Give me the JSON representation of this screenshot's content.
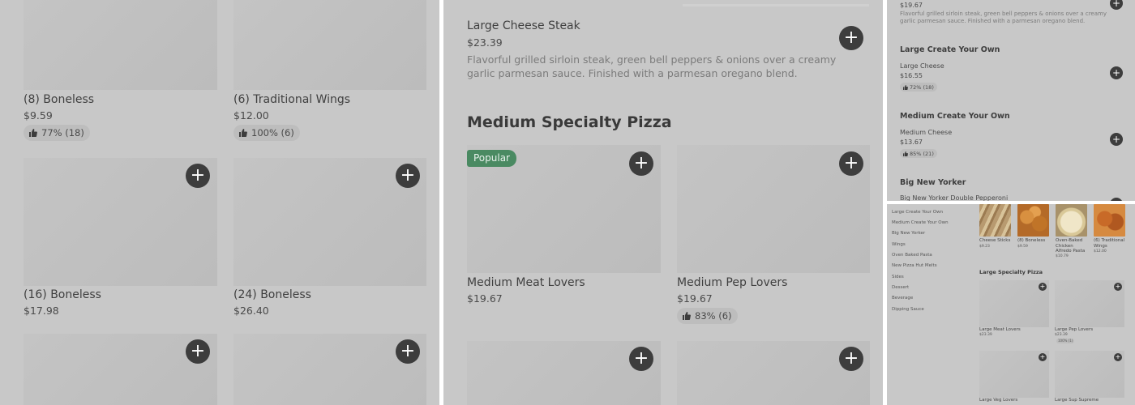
{
  "panel1": {
    "items": [
      {
        "name": "(8) Boneless",
        "price": "$9.59",
        "rating": "77% (18)"
      },
      {
        "name": "(6) Traditional Wings",
        "price": "$12.00",
        "rating": "100% (6)"
      },
      {
        "name": "(16) Boneless",
        "price": "$17.98"
      },
      {
        "name": "(24) Boneless",
        "price": "$26.40"
      }
    ],
    "add_symbol": "+"
  },
  "panel2": {
    "item": {
      "name": "Large Cheese Steak",
      "price": "$23.39",
      "description": "Flavorful grilled sirloin steak, green bell peppers & onions over a creamy garlic parmesan sauce. Finished with a parmesan oregano blend."
    },
    "section_title": "Medium Specialty Pizza",
    "badge": "Popular",
    "items": [
      {
        "name": "Medium Meat Lovers",
        "price": "$19.67"
      },
      {
        "name": "Medium Pep Lovers",
        "price": "$19.67",
        "rating": "83% (6)"
      }
    ],
    "add_symbol": "+"
  },
  "panel3": {
    "top_price": "$19.67",
    "top_description": "Flavorful grilled sirloin steak, green bell peppers & onions over a creamy garlic parmesan sauce. Finished with a parmesan oregano blend.",
    "sections": [
      {
        "title": "Large Create Your Own",
        "item": "Large Cheese",
        "price": "$16.55",
        "rating": "72% (18)"
      },
      {
        "title": "Medium Create Your Own",
        "item": "Medium Cheese",
        "price": "$13.67",
        "rating": "85% (21)"
      },
      {
        "title": "Big New Yorker",
        "item": "Big New Yorker Double Pepperoni"
      }
    ],
    "add_symbol": "+"
  },
  "panel4": {
    "nav": [
      "Large Create Your Own",
      "Medium Create Your Own",
      "Big New Yorker",
      "Wings",
      "Oven Baked Pasta",
      "New Pizza Hut Melts",
      "Sides",
      "Dessert",
      "Beverage",
      "Dipping Sauce"
    ],
    "top_items": [
      {
        "name": "Cheese Sticks",
        "price": "$9.23"
      },
      {
        "name": "(8) Boneless",
        "price": "$9.59"
      },
      {
        "name": "Oven-Baked Chicken Alfredo Pasta",
        "price": "$10.79"
      },
      {
        "name": "(6) Traditional Wings",
        "price": "$12.00"
      }
    ],
    "section_title": "Large Specialty Pizza",
    "items": [
      {
        "name": "Large Meat Lovers",
        "price": "$23.39"
      },
      {
        "name": "Large Pep Lovers",
        "price": "$23.39",
        "rating": "100% (1)"
      },
      {
        "name": "Large Veg Lovers"
      },
      {
        "name": "Large Sup Supreme"
      }
    ],
    "add_symbol": "+"
  },
  "colors": {
    "overlay": "#c8c8c8",
    "add_button": "#3d3d3d",
    "badge": "#4a8a62"
  }
}
